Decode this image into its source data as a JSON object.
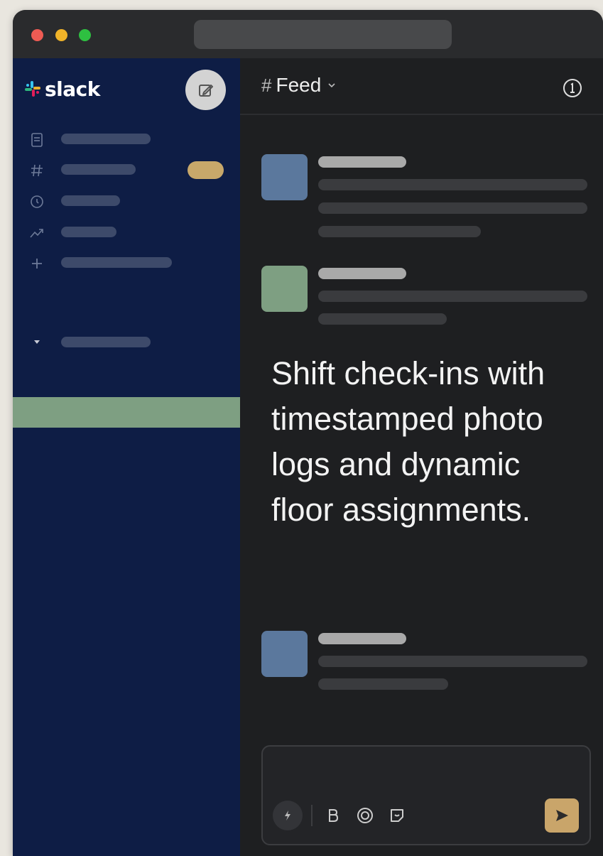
{
  "app": {
    "brand_name": "slack"
  },
  "sidebar": {
    "icons": [
      "document-icon",
      "hash-icon",
      "clock-icon",
      "trend-icon",
      "plus-icon",
      "caret-down-icon"
    ],
    "compose_icon": "compose-icon"
  },
  "channel": {
    "hash": "#",
    "name": "Feed",
    "info_icon": "info-icon"
  },
  "feed": {
    "highlight_message": "Shift check-ins with timestamped photo logs and dynamic floor assignments."
  },
  "composer": {
    "tools": [
      "shortcut-icon",
      "bold-icon",
      "emoji-icon",
      "sticker-icon"
    ],
    "send_icon": "send-icon"
  },
  "colors": {
    "sidebar_bg": "#0e1d45",
    "active_row": "#7e9f82",
    "badge": "#c8a86a",
    "avatar_blue": "#5b789d",
    "avatar_green": "#7e9f82",
    "send_button": "#c9a56a"
  }
}
